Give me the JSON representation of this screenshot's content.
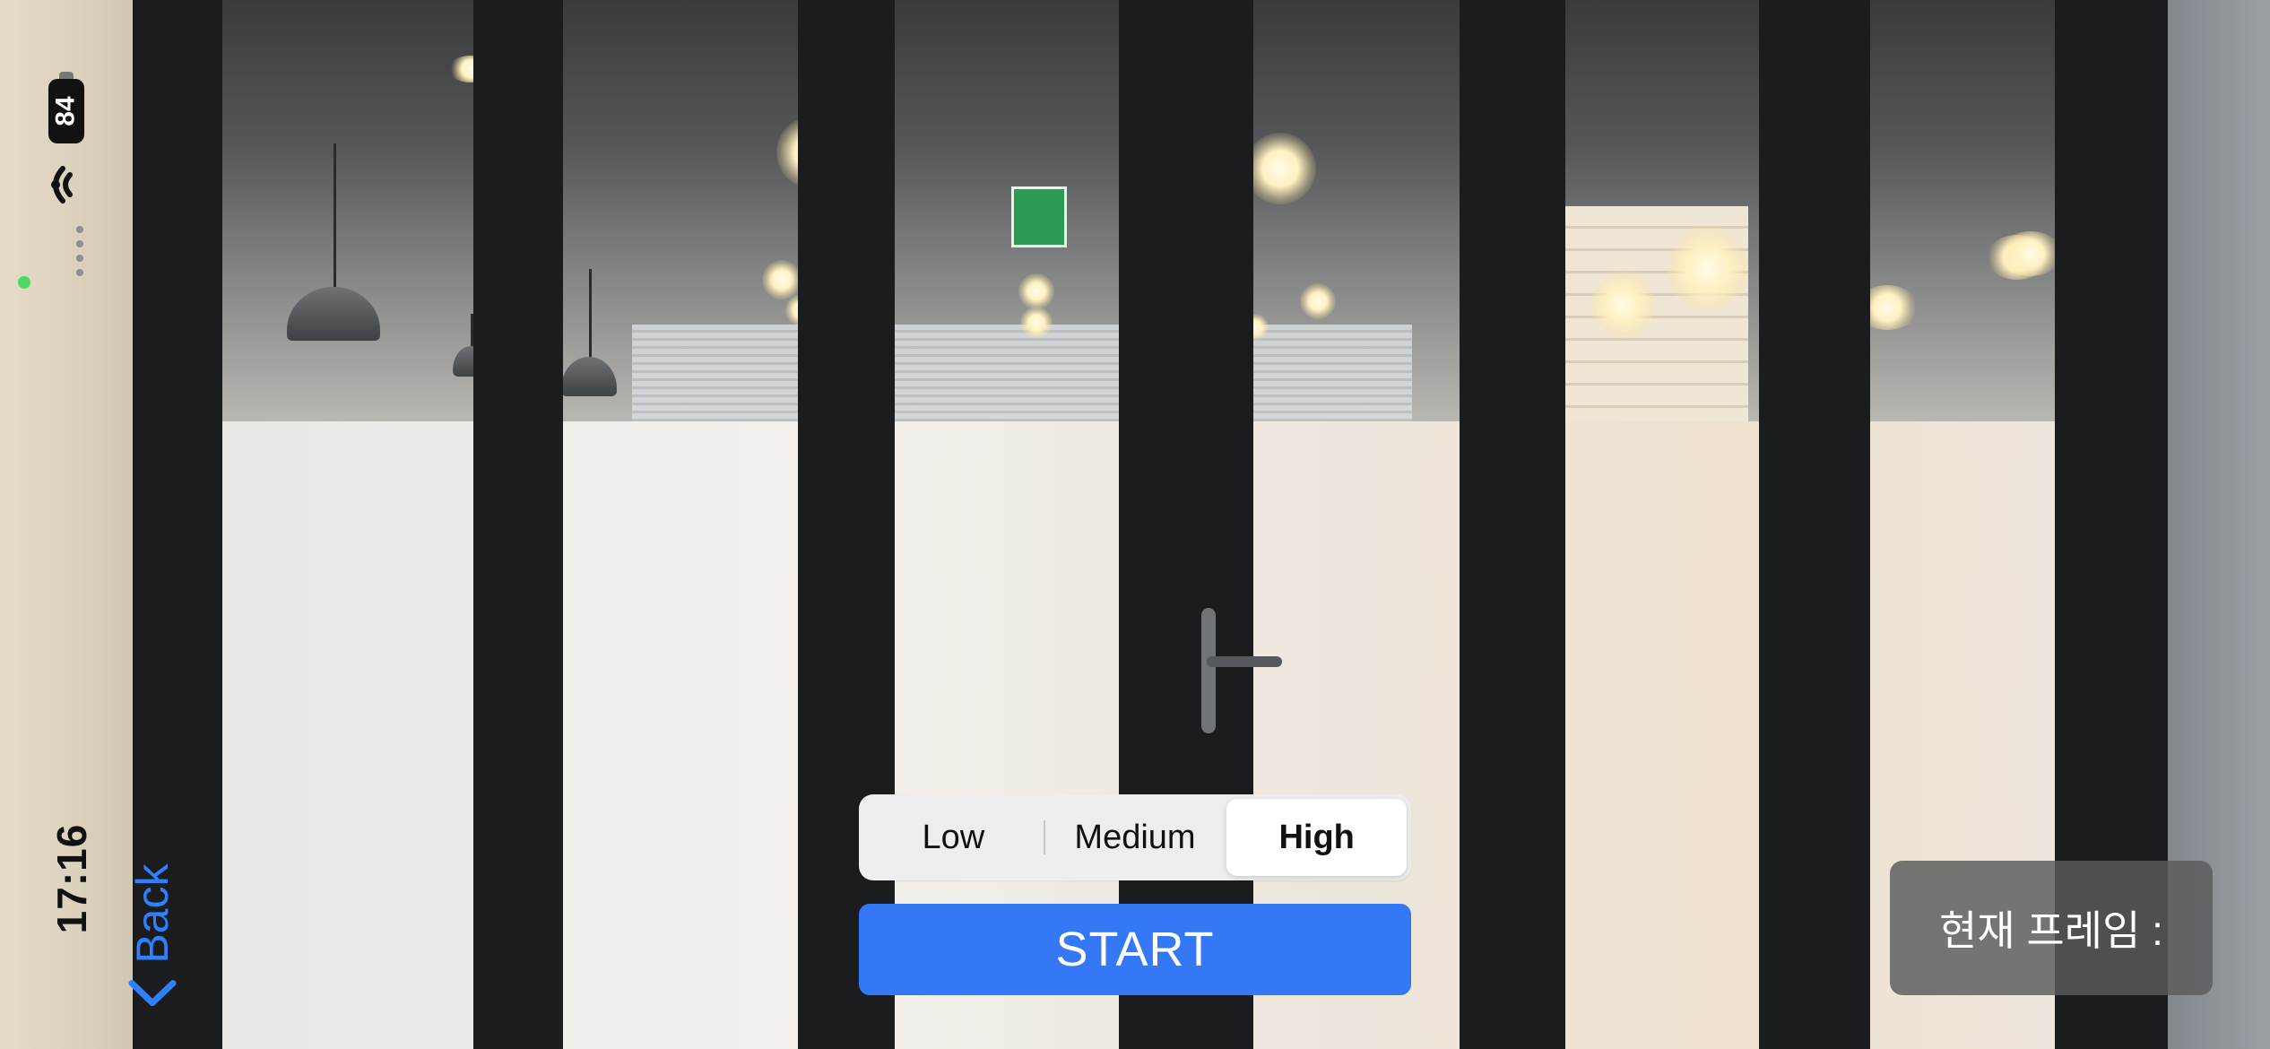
{
  "status_bar": {
    "time": "17:16",
    "battery_level": "84",
    "wifi_icon": "wifi-icon",
    "colors": {
      "text": "#111111",
      "privacy_indicator": "#4cd964"
    }
  },
  "navigation": {
    "back_label": "Back",
    "back_icon": "chevron-left-icon",
    "color": "#2f80ff"
  },
  "quality_selector": {
    "options": [
      {
        "label": "Low",
        "selected": false
      },
      {
        "label": "Medium",
        "selected": false
      },
      {
        "label": "High",
        "selected": true
      }
    ],
    "selected": "High"
  },
  "start_button": {
    "label": "START",
    "color": "#3478f6"
  },
  "frame_info": {
    "label": "현재 프레임 :"
  }
}
